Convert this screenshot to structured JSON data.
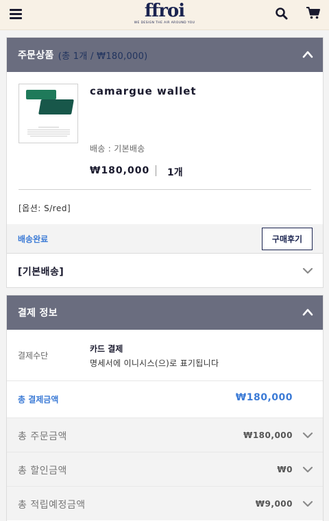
{
  "header": {
    "logo_text": "ffroi",
    "logo_tagline": "WE DESIGN THE AIR AROUND YOU"
  },
  "order_panel": {
    "title": "주문상품",
    "summary": "(총 1개 / ₩180,000)"
  },
  "product": {
    "name": "camargue wallet",
    "shipping": "배송 : 기본배송",
    "price": "₩180,000",
    "quantity": "1개",
    "option": "[옵션: S/red]",
    "status": "배송완료",
    "review_button": "구매후기"
  },
  "shipping_group": {
    "label": "[기본배송]"
  },
  "payment_panel": {
    "title": "결제 정보",
    "method_label": "결제수단",
    "method_value": "카드 결제",
    "method_note": "명세서에 이니시스(으)로 표기됩니다",
    "total_label": "총 결제금액",
    "total_value": "₩180,000"
  },
  "summary_rows": [
    {
      "label": "총 주문금액",
      "value": "₩180,000"
    },
    {
      "label": "총 할인금액",
      "value": "₩0"
    },
    {
      "label": "총 적립예정금액",
      "value": "₩9,000"
    }
  ],
  "colors": {
    "header_bg": "#f8f1e6",
    "panel_head_bg": "#6a6d7f",
    "brand_navy": "#1b2450",
    "accent_blue": "#3c7bd6"
  },
  "icons": [
    "menu-icon",
    "search-icon",
    "cart-icon",
    "chevron-up-icon",
    "chevron-down-icon"
  ]
}
